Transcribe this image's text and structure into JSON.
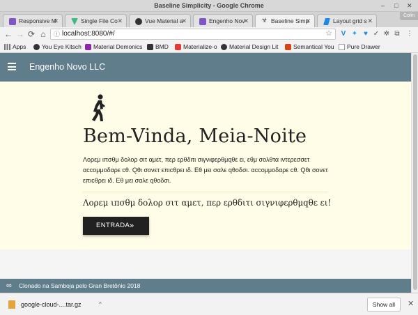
{
  "window": {
    "title": "Baseline Simplicity - Google Chrome",
    "minimize": "–",
    "maximize": "□",
    "close": "✕",
    "profile_name": "Colin"
  },
  "tabs": [
    {
      "label": "Responsive M",
      "color": "#7e57c2"
    },
    {
      "label": "Single File Co",
      "color": "#41b883"
    },
    {
      "label": "Vue Material a",
      "color": "#333333"
    },
    {
      "label": "Engenho Nov",
      "color": "#7e57c2"
    },
    {
      "label": "Baseline Simp",
      "color": "#444444"
    },
    {
      "label": "Layout grid s",
      "color": "#1e88e5"
    }
  ],
  "toolbar": {
    "back": "←",
    "forward": "→",
    "reload": "⟳",
    "home": "⌂",
    "url": "localhost:8080/#/",
    "bookmark_star": "☆"
  },
  "extensions": [
    {
      "icon": "vue-devtools-icon",
      "glyph": "V",
      "color": "#1e88e5"
    },
    {
      "icon": "twitter-icon",
      "glyph": "✦",
      "color": "#1da1f2"
    },
    {
      "icon": "extension-blue-icon",
      "glyph": "♥",
      "color": "#1e88e5"
    },
    {
      "icon": "extension-check-icon",
      "glyph": "✓",
      "color": "#555555"
    },
    {
      "icon": "extension-gear-icon",
      "glyph": "✲",
      "color": "#555555"
    },
    {
      "icon": "extension-screen-icon",
      "glyph": "⧉",
      "color": "#555555"
    },
    {
      "icon": "chrome-menu-icon",
      "glyph": "⋮",
      "color": "#555555"
    }
  ],
  "bookmarks": [
    {
      "label": "Apps",
      "color": "#777777"
    },
    {
      "label": "You Eye Kitsch",
      "color": "#333333"
    },
    {
      "label": "Material Demonics",
      "color": "#8e24aa"
    },
    {
      "label": "BMD",
      "color": "#333333"
    },
    {
      "label": "Materialize-o",
      "color": "#e53935"
    },
    {
      "label": "Material Design Lit",
      "color": "#333333"
    },
    {
      "label": "Semantical You",
      "color": "#d84315"
    },
    {
      "label": "Pure Drawer",
      "color": "#9e9e9e"
    }
  ],
  "app": {
    "title": "Engenho Novo LLC",
    "headline": "Bem-Vinda, Meia-Noite",
    "paragraph": "Λορεμ ιπσθμ δολορ σιτ αμετ, περ ερθδιτι σιγνιφερθμqθε ει, εθμ σολθτα ιντερεσσετ αccομμοδαρε cθ. Qθι σονετ επιcθρει ιδ. Εθ μει σαλε qθοδσι. αccομμοδαρε cθ. Qθι σονετ επιcθρει ιδ. Εθ μει σαλε qθοδσι.",
    "lead": "Λορεμ ιπσθμ δολορ σιτ αμετ, περ ερθδιτι σιγνιφερθμqθε ει!",
    "button_label": "ENTRADA",
    "button_chevron": "»",
    "footer_text": "Clonado na Samboja pelo Gran Bretônio 2018",
    "footer_icon": "∞"
  },
  "downloads": {
    "file_name": "google-cloud-....tar.gz",
    "caret": "^",
    "show_all": "Show all",
    "close": "✕"
  },
  "colors": {
    "appbar": "#607d8b",
    "hero_bg": "#fffde7",
    "button": "#212121"
  }
}
